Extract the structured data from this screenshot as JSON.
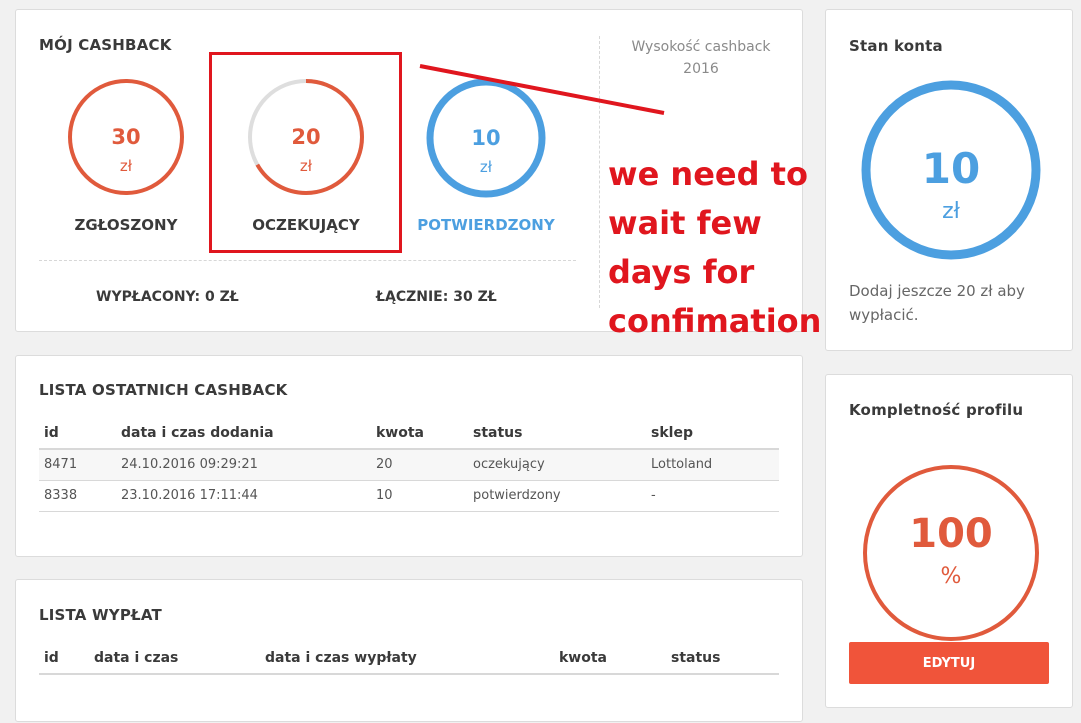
{
  "colors": {
    "orange": "#e05a3c",
    "blue": "#4c9fe0",
    "grey_track": "#dedede",
    "annotation_red": "#e0161e",
    "button": "#f0543a"
  },
  "cashback": {
    "title": "MÓJ CASHBACK",
    "height_label": "Wysokość cashback",
    "height_year": "2016",
    "stats": [
      {
        "value": "30",
        "unit": "zł",
        "label": "ZGŁOSZONY",
        "fraction": 1.0
      },
      {
        "value": "20",
        "unit": "zł",
        "label": "OCZEKUJĄCY",
        "fraction": 0.667
      },
      {
        "value": "10",
        "unit": "zł",
        "label": "POTWIERDZONY",
        "fraction": 1.0
      }
    ],
    "paid_out": "WYPŁACONY: 0 ZŁ",
    "total": "ŁĄCZNIE: 30 ZŁ"
  },
  "annotation": {
    "text": "we need to wait few days for confimation"
  },
  "recent_list": {
    "title": "LISTA OSTATNICH CASHBACK",
    "columns": [
      "id",
      "data i czas dodania",
      "kwota",
      "status",
      "sklep"
    ],
    "rows": [
      [
        "8471",
        "24.10.2016 09:29:21",
        "20",
        "oczekujący",
        "Lottoland"
      ],
      [
        "8338",
        "23.10.2016 17:11:44",
        "10",
        "potwierdzony",
        "-"
      ]
    ]
  },
  "payouts": {
    "title": "LISTA WYPŁAT",
    "columns": [
      "id",
      "data i czas",
      "data i czas wypłaty",
      "kwota",
      "status"
    ]
  },
  "account": {
    "title": "Stan konta",
    "value": "10",
    "unit": "zł",
    "note": "Dodaj jeszcze 20 zł aby wypłacić."
  },
  "profile": {
    "title": "Kompletność profilu",
    "value": "100",
    "unit": "%",
    "fraction": 1.0,
    "edit_label": "EDYTUJ"
  }
}
